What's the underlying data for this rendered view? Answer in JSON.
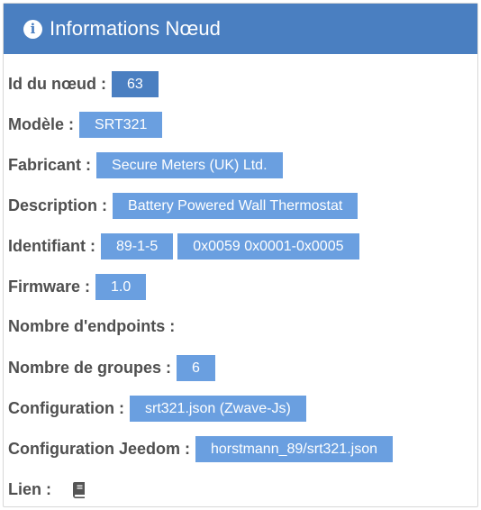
{
  "panel": {
    "title": "Informations Nœud",
    "icon": "info-circle-icon",
    "header_color": "#4a7fc1",
    "badge_color": "#6a9fe0"
  },
  "fields": {
    "node_id": {
      "label": "Id du nœud :",
      "value": "63"
    },
    "model": {
      "label": "Modèle :",
      "value": "SRT321"
    },
    "manufacturer": {
      "label": "Fabricant :",
      "value": "Secure Meters (UK) Ltd."
    },
    "description": {
      "label": "Description :",
      "value": "Battery Powered Wall Thermostat"
    },
    "identifier": {
      "label": "Identifiant :",
      "value": "89-1-5",
      "value2": "0x0059 0x0001-0x0005"
    },
    "firmware": {
      "label": "Firmware :",
      "value": "1.0"
    },
    "endpoints": {
      "label": "Nombre d'endpoints :"
    },
    "groups": {
      "label": "Nombre de groupes :",
      "value": "6"
    },
    "configuration": {
      "label": "Configuration :",
      "value": "srt321.json (Zwave-Js)"
    },
    "jeedom_configuration": {
      "label": "Configuration Jeedom :",
      "value": "horstmann_89/srt321.json"
    },
    "link": {
      "label": "Lien :",
      "icon": "book-icon"
    }
  }
}
